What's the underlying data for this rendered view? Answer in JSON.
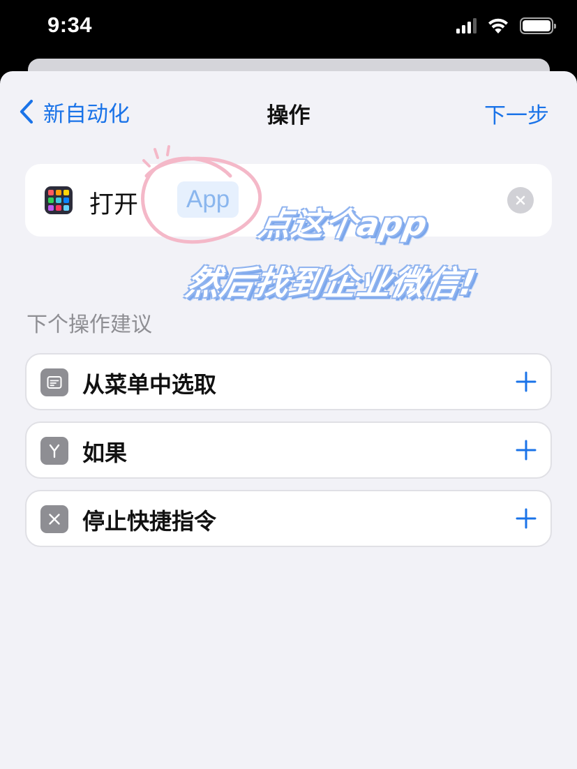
{
  "status_bar": {
    "time": "9:34",
    "icons": [
      "cellular-signal-icon",
      "wifi-icon",
      "battery-icon"
    ],
    "battery_level": 1.0
  },
  "nav": {
    "back_label": "新自动化",
    "title": "操作",
    "next_label": "下一步"
  },
  "action": {
    "label": "打开",
    "token": "App",
    "icon": "app-grid-icon",
    "clear_icon": "close-icon"
  },
  "annotation": {
    "line1": "点这个app",
    "line2": "然后找到企业微信!",
    "circle_color": "#f4b8c8"
  },
  "suggestions": {
    "header": "下个操作建议",
    "items": [
      {
        "label": "从菜单中选取",
        "icon": "menu-list-icon"
      },
      {
        "label": "如果",
        "icon": "branch-icon"
      },
      {
        "label": "停止快捷指令",
        "icon": "stop-x-icon"
      }
    ],
    "add_icon": "plus-icon"
  },
  "colors": {
    "accent": "#1a73e8",
    "sheet_background": "#f2f2f7",
    "token_background": "#e6f0fd",
    "token_text": "#8ab6ee",
    "secondary_text": "#8e8e93"
  }
}
